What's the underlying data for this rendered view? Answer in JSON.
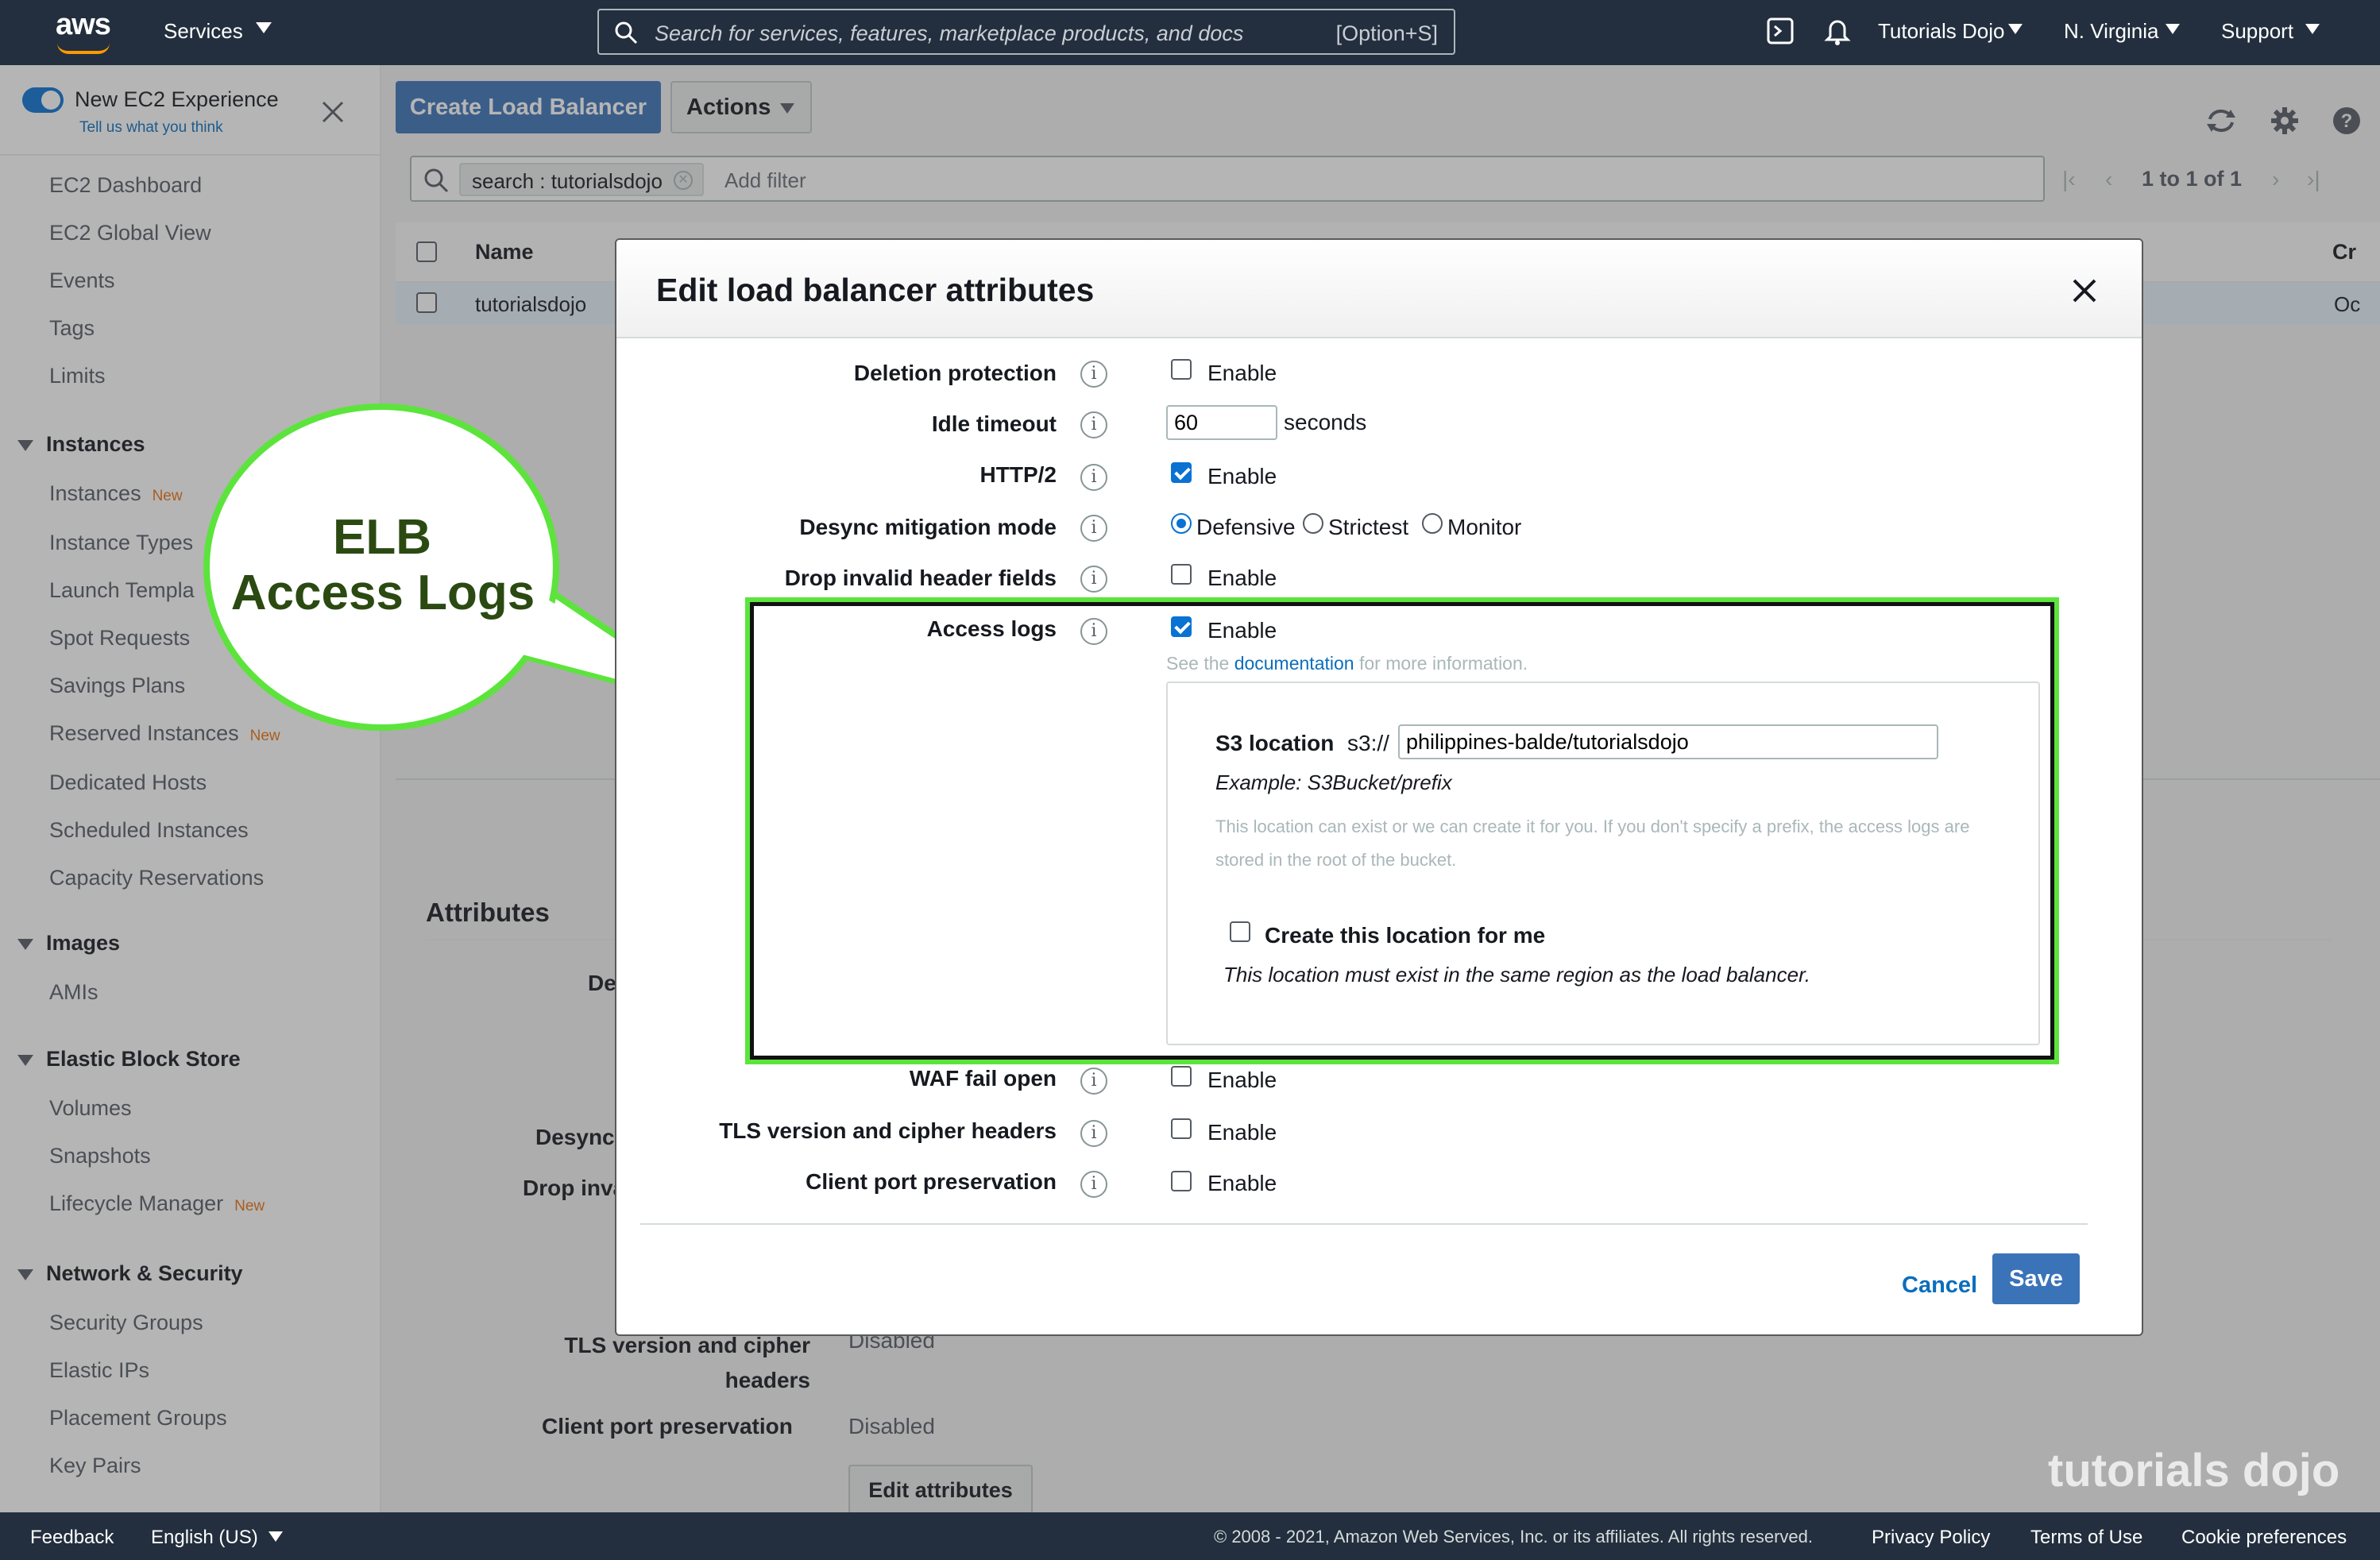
{
  "nav": {
    "logo": "aws",
    "services": "Services",
    "search_placeholder": "Search for services, features, marketplace products, and docs",
    "search_shortcut": "[Option+S]",
    "account": "Tutorials Dojo",
    "region": "N. Virginia",
    "support": "Support"
  },
  "sidebar": {
    "toggle_label": "New EC2 Experience",
    "toggle_sub": "Tell us what you think",
    "top_items": [
      "EC2 Dashboard",
      "EC2 Global View",
      "Events",
      "Tags",
      "Limits"
    ],
    "sections": [
      {
        "title": "Instances",
        "items": [
          {
            "label": "Instances",
            "badge": "New"
          },
          {
            "label": "Instance Types"
          },
          {
            "label": "Launch Templa"
          },
          {
            "label": "Spot Requests"
          },
          {
            "label": "Savings Plans"
          },
          {
            "label": "Reserved Instances",
            "badge": "New"
          },
          {
            "label": "Dedicated Hosts"
          },
          {
            "label": "Scheduled Instances"
          },
          {
            "label": "Capacity Reservations"
          }
        ]
      },
      {
        "title": "Images",
        "items": [
          {
            "label": "AMIs"
          }
        ]
      },
      {
        "title": "Elastic Block Store",
        "items": [
          {
            "label": "Volumes"
          },
          {
            "label": "Snapshots"
          },
          {
            "label": "Lifecycle Manager",
            "badge": "New"
          }
        ]
      },
      {
        "title": "Network & Security",
        "items": [
          {
            "label": "Security Groups"
          },
          {
            "label": "Elastic IPs"
          },
          {
            "label": "Placement Groups"
          },
          {
            "label": "Key Pairs"
          }
        ]
      }
    ]
  },
  "toolbar": {
    "create_label": "Create Load Balancer",
    "actions_label": "Actions"
  },
  "filter": {
    "token": "search : tutorialsdojo",
    "add_filter": "Add filter",
    "pagination": "1 to 1 of 1"
  },
  "table": {
    "col_name": "Name",
    "col_created": "Cr",
    "row_name": "tutorialsdojo",
    "row_created": "Oc"
  },
  "background": {
    "section": "Attributes",
    "fragments": [
      "De",
      "Desync",
      "Drop inva"
    ],
    "rows": [
      {
        "label": "TLS version and cipher headers",
        "value": "Disabled"
      },
      {
        "label": "Client port preservation",
        "value": "Disabled"
      }
    ],
    "edit_button": "Edit attributes"
  },
  "modal": {
    "title": "Edit load balancer attributes",
    "deletion_protection": {
      "label": "Deletion protection",
      "option": "Enable",
      "checked": false
    },
    "idle_timeout": {
      "label": "Idle timeout",
      "value": "60",
      "unit": "seconds"
    },
    "http2": {
      "label": "HTTP/2",
      "option": "Enable",
      "checked": true
    },
    "desync": {
      "label": "Desync mitigation mode",
      "options": [
        "Defensive",
        "Strictest",
        "Monitor"
      ],
      "selected": "Defensive"
    },
    "drop_invalid": {
      "label": "Drop invalid header fields",
      "option": "Enable",
      "checked": false
    },
    "access_logs": {
      "label": "Access logs",
      "option": "Enable",
      "checked": true,
      "help_prefix": "See the",
      "help_link": "documentation",
      "help_suffix": "for more information.",
      "s3_label": "S3 location",
      "s3_prefix": "s3://",
      "s3_value": "philippines-balde/tutorialsdojo",
      "example": "Example: S3Bucket/prefix",
      "desc": "This location can exist or we can create it for you. If you don't specify a prefix, the access logs are stored in the root of the bucket.",
      "create_label": "Create this location for me",
      "create_note": "This location must exist in the same region as the load balancer."
    },
    "waf": {
      "label": "WAF fail open",
      "option": "Enable",
      "checked": false
    },
    "tls": {
      "label": "TLS version and cipher headers",
      "option": "Enable",
      "checked": false
    },
    "client_port": {
      "label": "Client port preservation",
      "option": "Enable",
      "checked": false
    },
    "cancel": "Cancel",
    "save": "Save"
  },
  "callout": {
    "line1": "ELB",
    "line2": "Access Logs"
  },
  "watermark": "tutorials dojo",
  "footer": {
    "feedback": "Feedback",
    "language": "English (US)",
    "copyright": "© 2008 - 2021, Amazon Web Services, Inc. or its affiliates. All rights reserved.",
    "privacy": "Privacy Policy",
    "terms": "Terms of Use",
    "cookies": "Cookie preferences"
  },
  "colors": {
    "nav": "#232f3e",
    "primary": "#3b73b9",
    "highlight": "#5ce43c",
    "callout_text": "#2b4a12",
    "link": "#0a6ebd"
  }
}
